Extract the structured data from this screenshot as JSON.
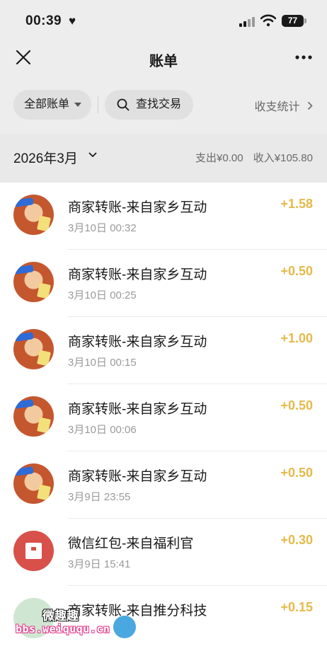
{
  "status_bar": {
    "time": "00:39",
    "battery": "77"
  },
  "nav": {
    "title": "账单"
  },
  "filters": {
    "all_bills": "全部账单",
    "search": "查找交易",
    "stats": "收支统计"
  },
  "month_row": {
    "month": "2026年3月",
    "expense": "支出¥0.00",
    "income": "收入¥105.80"
  },
  "transactions": [
    {
      "title": "商家转账-来自家乡互动",
      "time": "3月10日 00:32",
      "amount": "+1.58",
      "avatar": "game-avatar"
    },
    {
      "title": "商家转账-来自家乡互动",
      "time": "3月10日 00:25",
      "amount": "+0.50",
      "avatar": "game-avatar"
    },
    {
      "title": "商家转账-来自家乡互动",
      "time": "3月10日 00:15",
      "amount": "+1.00",
      "avatar": "game-avatar"
    },
    {
      "title": "商家转账-来自家乡互动",
      "time": "3月10日 00:06",
      "amount": "+0.50",
      "avatar": "game-avatar"
    },
    {
      "title": "商家转账-来自家乡互动",
      "time": "3月9日 23:55",
      "amount": "+0.50",
      "avatar": "game-avatar"
    },
    {
      "title": "微信红包-来自福利官",
      "time": "3月9日 15:41",
      "amount": "+0.30",
      "avatar": "red-packet-avatar"
    },
    {
      "title": "商家转账-来自推分科技",
      "time": "",
      "amount": "+0.15",
      "avatar": "merchant-avatar"
    }
  ],
  "watermark": {
    "title": "微趣趣",
    "url": "bbs.weiququ.cn"
  },
  "colors": {
    "accent_amount": "#e6b94a",
    "header_bg": "#ededed",
    "red_packet": "#d8504a"
  }
}
